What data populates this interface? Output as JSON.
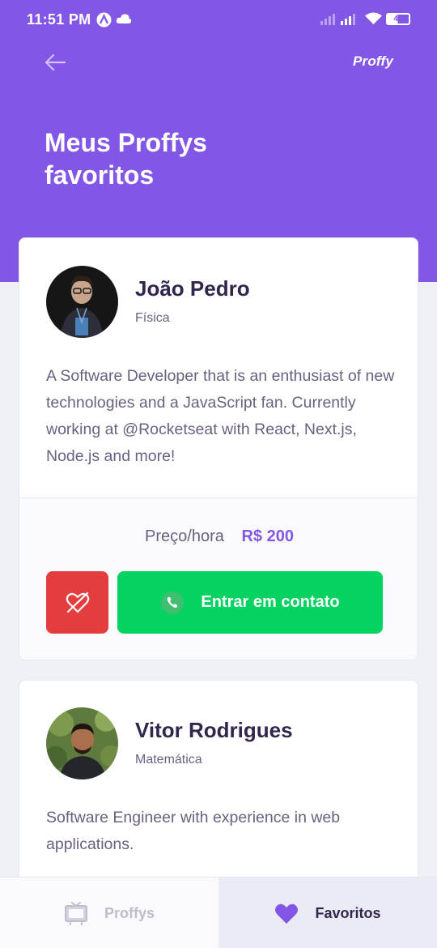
{
  "status_bar": {
    "time": "11:51 PM",
    "battery": "49"
  },
  "header": {
    "logo": "Proffy",
    "title_line1": "Meus Proffys",
    "title_line2": "favoritos"
  },
  "teachers": [
    {
      "name": "João Pedro",
      "subject": "Física",
      "bio": "A Software Developer that is an enthusiast of new technologies and a JavaScript fan. Currently working at @Rocketseat with React, Next.js, Node.js and more!",
      "price_label": "Preço/hora",
      "price_value": "R$ 200",
      "contact_label": "Entrar em contato"
    },
    {
      "name": "Vitor Rodrigues",
      "subject": "Matemática",
      "bio": "Software Engineer with experience in web applications."
    }
  ],
  "tabbar": {
    "tabs": [
      {
        "label": "Proffys",
        "icon": "tv-icon",
        "active": false
      },
      {
        "label": "Favoritos",
        "icon": "heart-icon",
        "active": true
      }
    ]
  },
  "colors": {
    "primary": "#8257E5",
    "title_text": "#32264D",
    "body_text": "#6A6180",
    "danger": "#E33D3D",
    "success": "#04D361",
    "background": "#F0F0F7"
  }
}
